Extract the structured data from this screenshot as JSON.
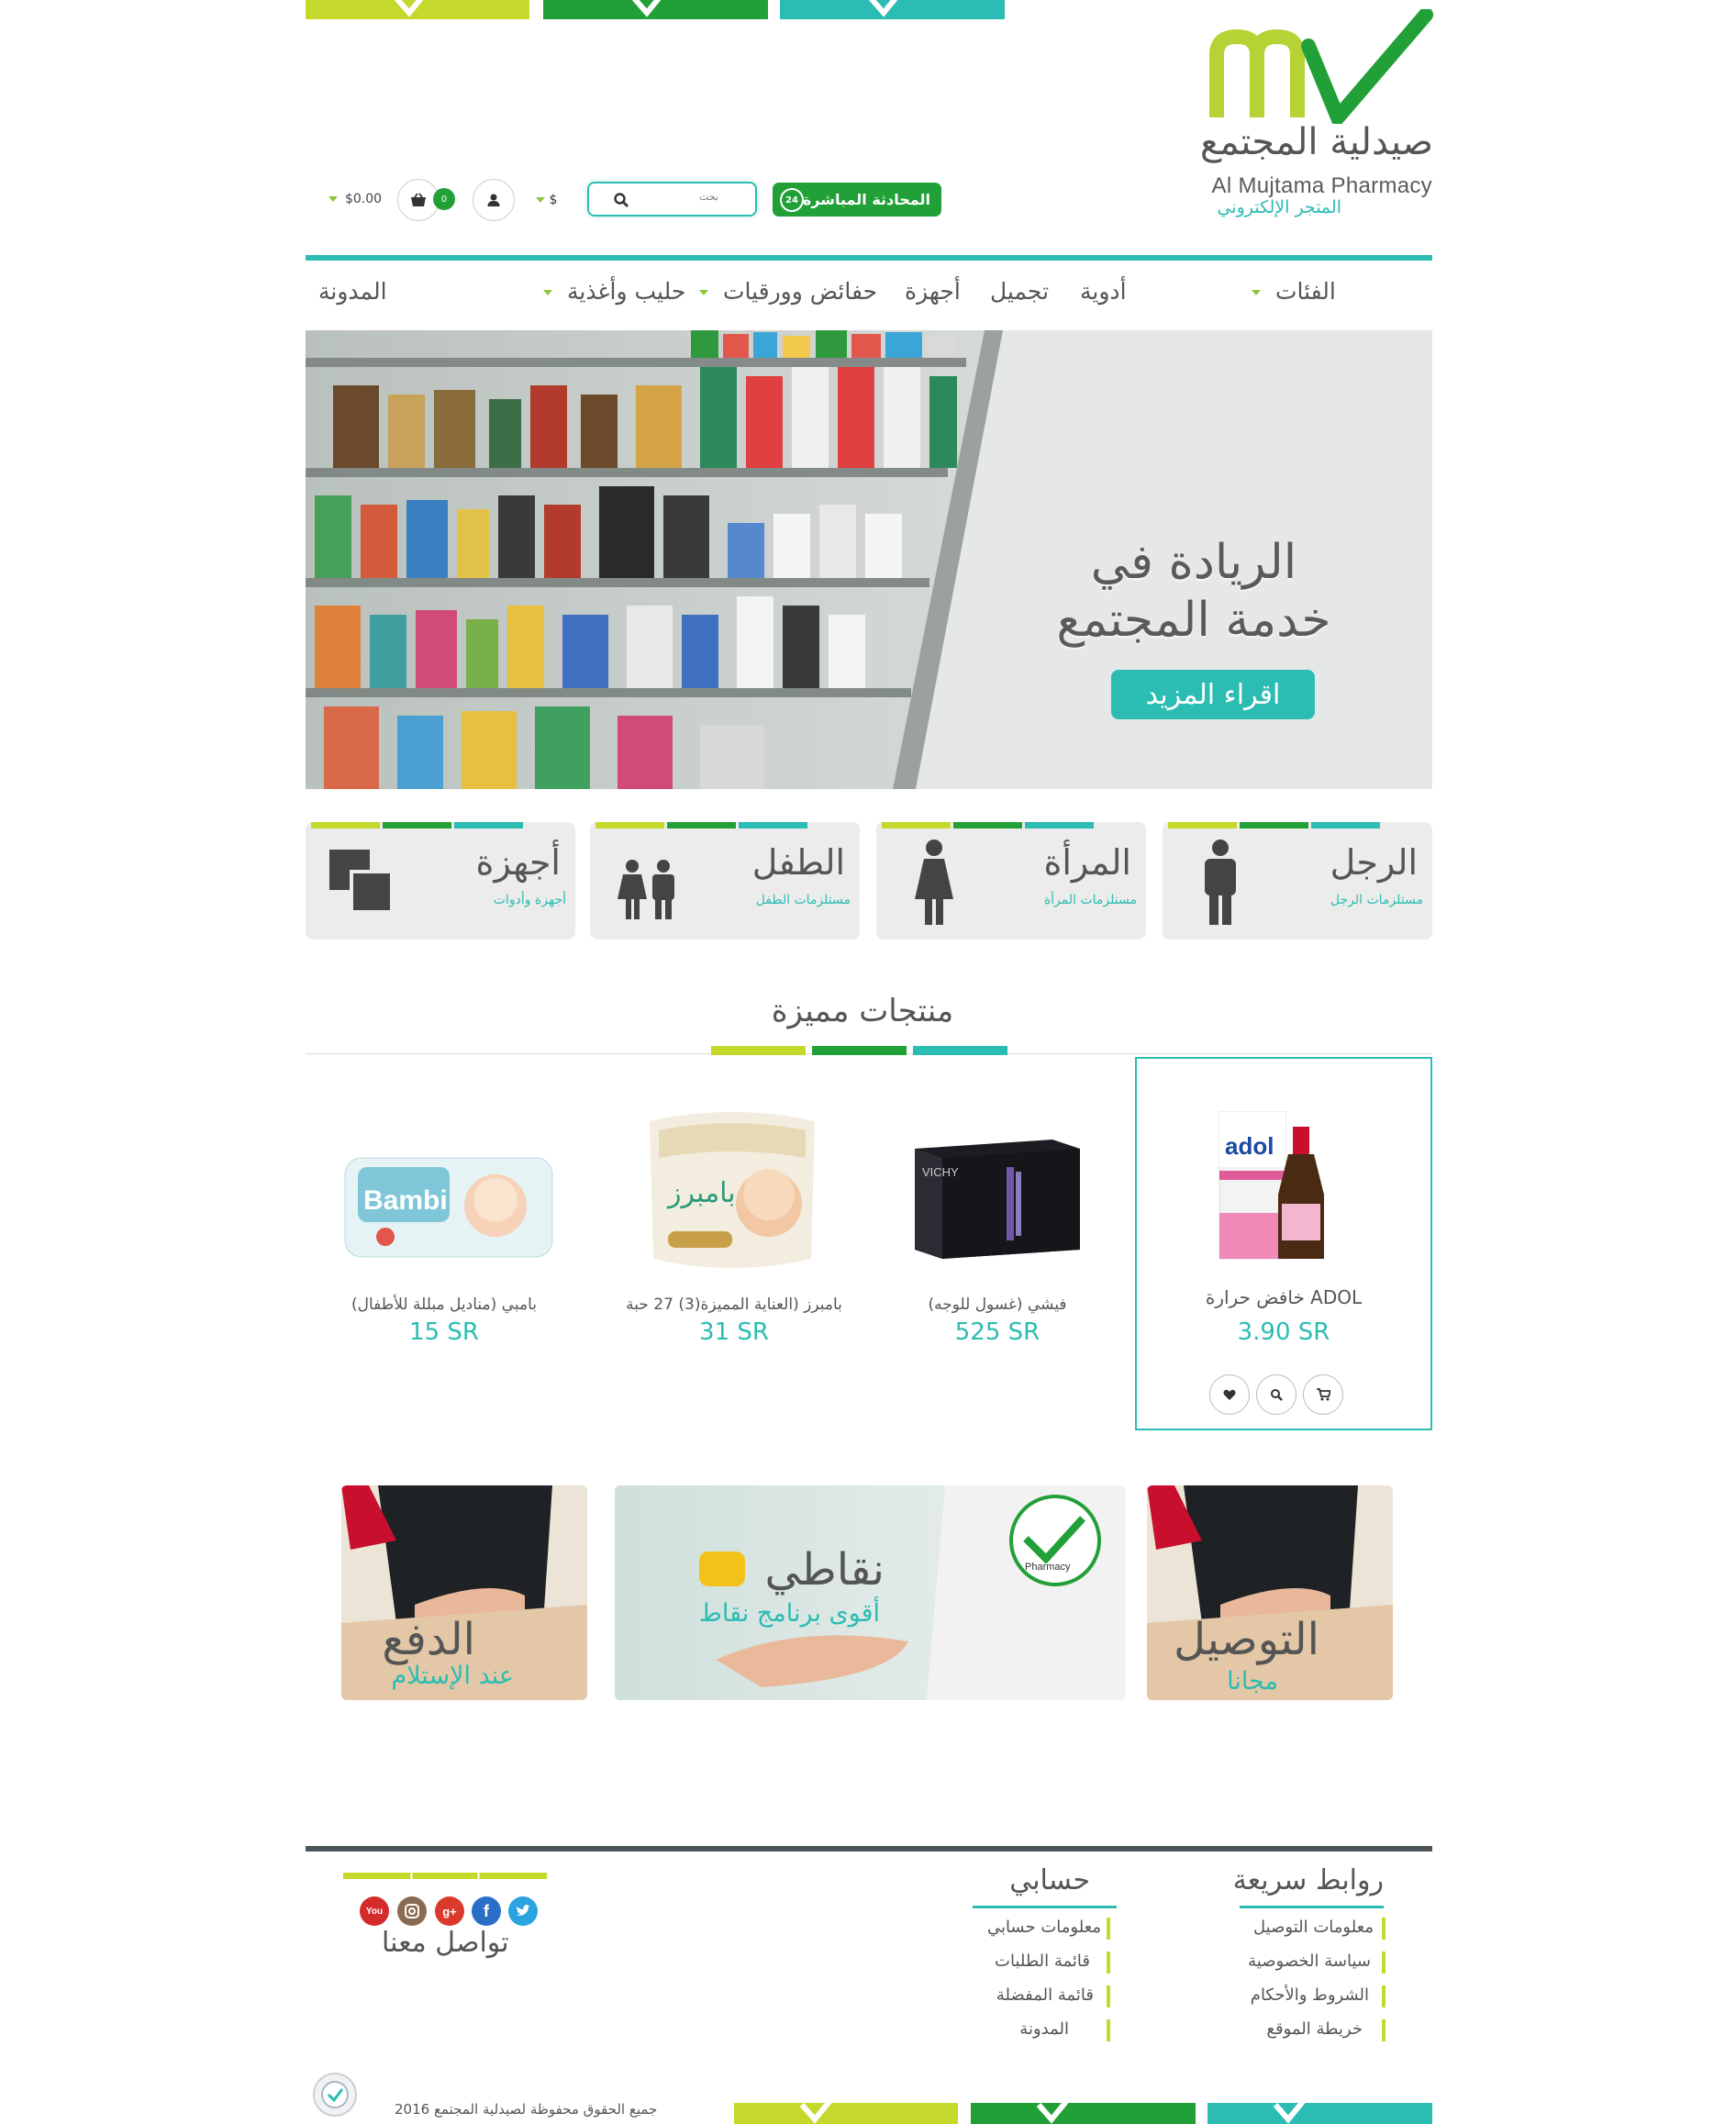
{
  "brand": {
    "name_ar": "صيدلية المجتمع",
    "name_en": "Al Mujtama Pharmacy",
    "subtitle": "المتجر الإلكتروني"
  },
  "header": {
    "chat_label": "المحادثة المباشرة",
    "chat_badge": "24",
    "search_placeholder": "بحث",
    "currency": "$",
    "cart_count": "0",
    "cart_total": "$0.00"
  },
  "nav": {
    "categories": "الفئات",
    "medicines": "أدوية",
    "cosmetics": "تجميل",
    "devices": "أجهزة",
    "diapers": "حفائض وورقيات",
    "milk": "حليب وأغذية",
    "blog": "المدونة"
  },
  "hero": {
    "line1": "الريادة في",
    "line2": "خدمة المجتمع",
    "button": "اقراء المزيد"
  },
  "categories": [
    {
      "title": "الرجل",
      "subtitle": "مستلزمات الرجل"
    },
    {
      "title": "المرأة",
      "subtitle": "مستلزمات المرأة"
    },
    {
      "title": "الطفل",
      "subtitle": "مستلزمات الطفل"
    },
    {
      "title": "أجهزة",
      "subtitle": "أجهزة وأدوات"
    }
  ],
  "featured": {
    "title": "منتجات مميزة",
    "products": [
      {
        "name": "ADOL خافض حرارة",
        "price": "3.90 SR",
        "pack_label": "adol"
      },
      {
        "name": "فيشي (غسول للوجه)",
        "price": "525 SR",
        "pack_label": "VICHY"
      },
      {
        "name": "بامبرز (العناية المميزة(3) 27 حبة",
        "price": "31 SR",
        "pack_label": "بامبرز"
      },
      {
        "name": "بامبي (مناديل مبللة للأطفال)",
        "price": "15 SR",
        "pack_label": "Bambi"
      }
    ]
  },
  "promos": {
    "delivery_big": "التوصيل",
    "delivery_small": "مجانا",
    "points_big": "نقاطي",
    "points_small": "أقوى برنامج نقاط",
    "points_badge": "Pharmacy",
    "cod_big": "الدفع",
    "cod_small": "عند الإستلام"
  },
  "footer": {
    "quick_title": "روابط سريعة",
    "quick_links": [
      "معلومات التوصيل",
      "سياسة الخصوصية",
      "الشروط والأحكام",
      "خريطة الموقع"
    ],
    "account_title": "حسابي",
    "account_links": [
      "معلومات حسابي",
      "قائمة الطلبات",
      "قائمة المفضلة",
      "المدونة"
    ],
    "contact_title": "تواصل معنا",
    "social": [
      "twitter-icon",
      "facebook-icon",
      "google-plus-icon",
      "instagram-icon",
      "youtube-icon"
    ],
    "copyright": "جميع الحقوق محفوظة لصيدلية المجتمع 2016"
  },
  "colors": {
    "lime": "#c5d92d",
    "green": "#21a037",
    "teal": "#2bbcb3",
    "dark": "#4b5458"
  }
}
